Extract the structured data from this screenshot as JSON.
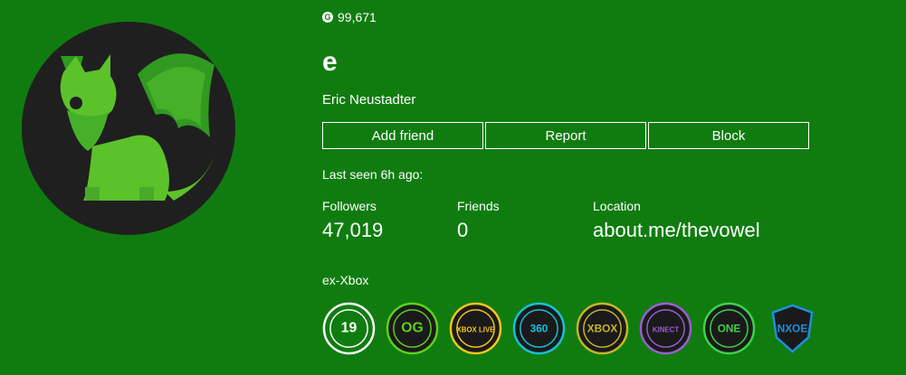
{
  "profile": {
    "gamerscore": "99,671",
    "gamertag": "e",
    "real_name": "Eric Neustadter",
    "last_seen": "Last seen 6h ago:",
    "bio": "ex-Xbox"
  },
  "actions": {
    "add_friend": "Add friend",
    "report": "Report",
    "block": "Block"
  },
  "stats": {
    "followers": {
      "label": "Followers",
      "value": "47,019"
    },
    "friends": {
      "label": "Friends",
      "value": "0"
    },
    "location": {
      "label": "Location",
      "value": "about.me/thevowel"
    }
  },
  "badges": [
    {
      "icon": "19-year-badge-icon",
      "text": "19",
      "color": "#ffffff"
    },
    {
      "icon": "og-launch-team-badge-icon",
      "text": "OG",
      "color": "#5fd01b"
    },
    {
      "icon": "xbox-live-launch-team-badge-icon",
      "text": "XBOX LIVE",
      "color": "#f7c51d"
    },
    {
      "icon": "360-launch-team-badge-icon",
      "text": "360",
      "color": "#16c2d8"
    },
    {
      "icon": "new-xbox-experience-badge-icon",
      "text": "XBOX",
      "color": "#c7b52b"
    },
    {
      "icon": "kinect-launch-team-badge-icon",
      "text": "KINECT",
      "color": "#9a5fd1"
    },
    {
      "icon": "one-launch-team-badge-icon",
      "text": "ONE",
      "color": "#3fd04c"
    },
    {
      "icon": "nxoe-badge-icon",
      "text": "NXOE",
      "color": "#1f8fe0"
    }
  ],
  "colors": {
    "background": "#107c10",
    "avatar_bg": "#1f1f1f",
    "avatar_dragon": "#5cc22a"
  }
}
